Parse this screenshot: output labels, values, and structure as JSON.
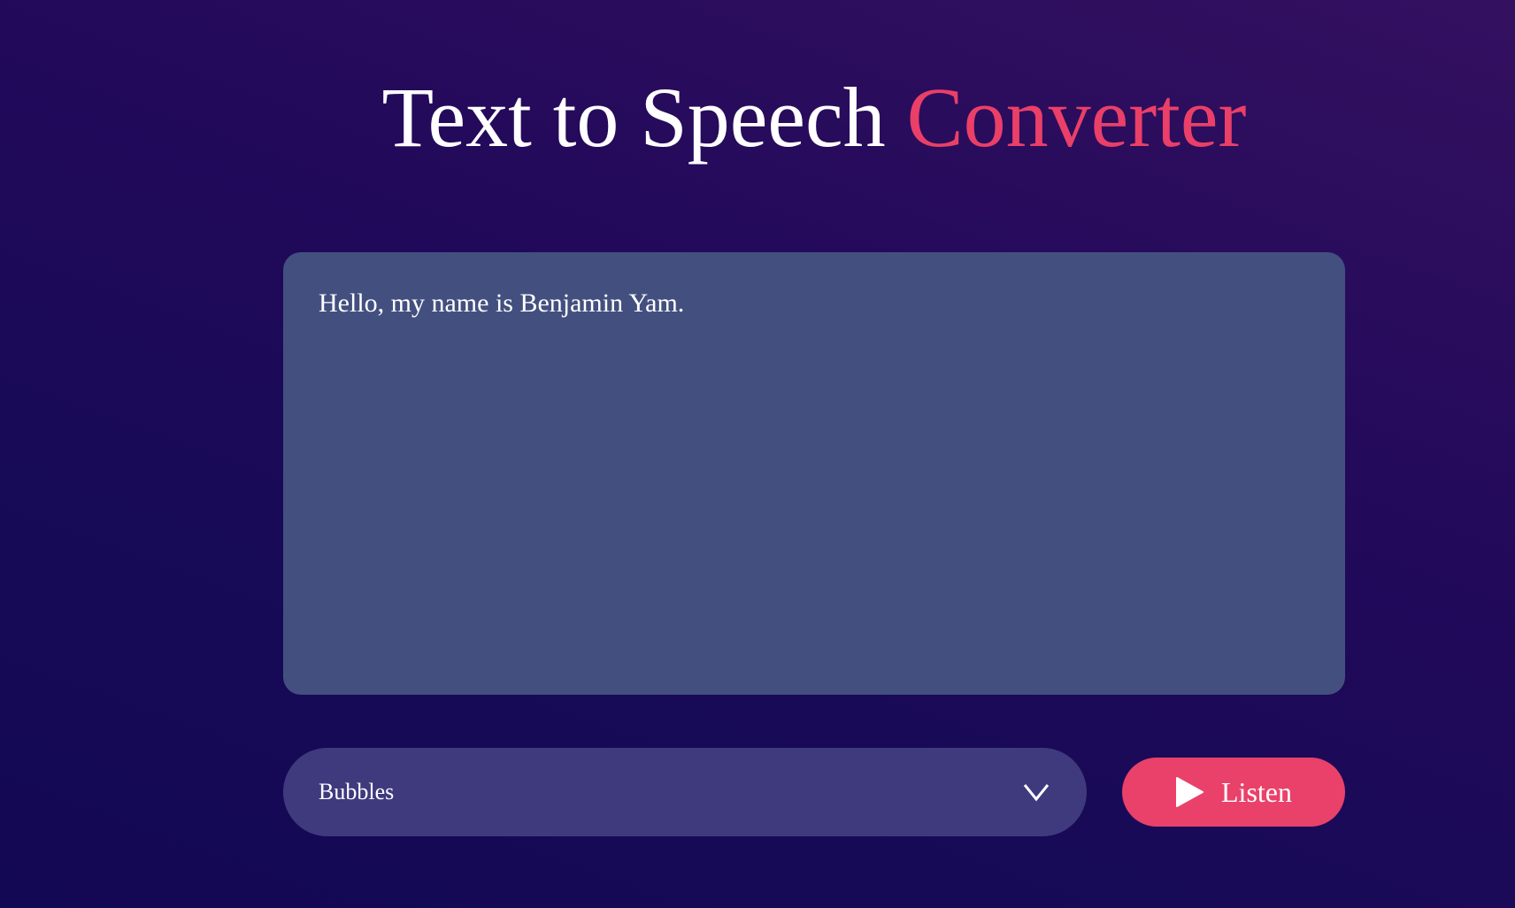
{
  "header": {
    "title_main": "Text to Speech",
    "title_accent": "Converter"
  },
  "editor": {
    "value": "Hello, my name is Benjamin Yam.",
    "placeholder": ""
  },
  "voice_select": {
    "selected": "Bubbles",
    "icon": "chevron-down-icon"
  },
  "listen_button": {
    "label": "Listen",
    "icon": "play-icon"
  },
  "colors": {
    "accent": "#ea3f68",
    "editor_bg": "#43507f",
    "select_bg": "#3f3a7e",
    "button_bg": "#e9416a"
  }
}
